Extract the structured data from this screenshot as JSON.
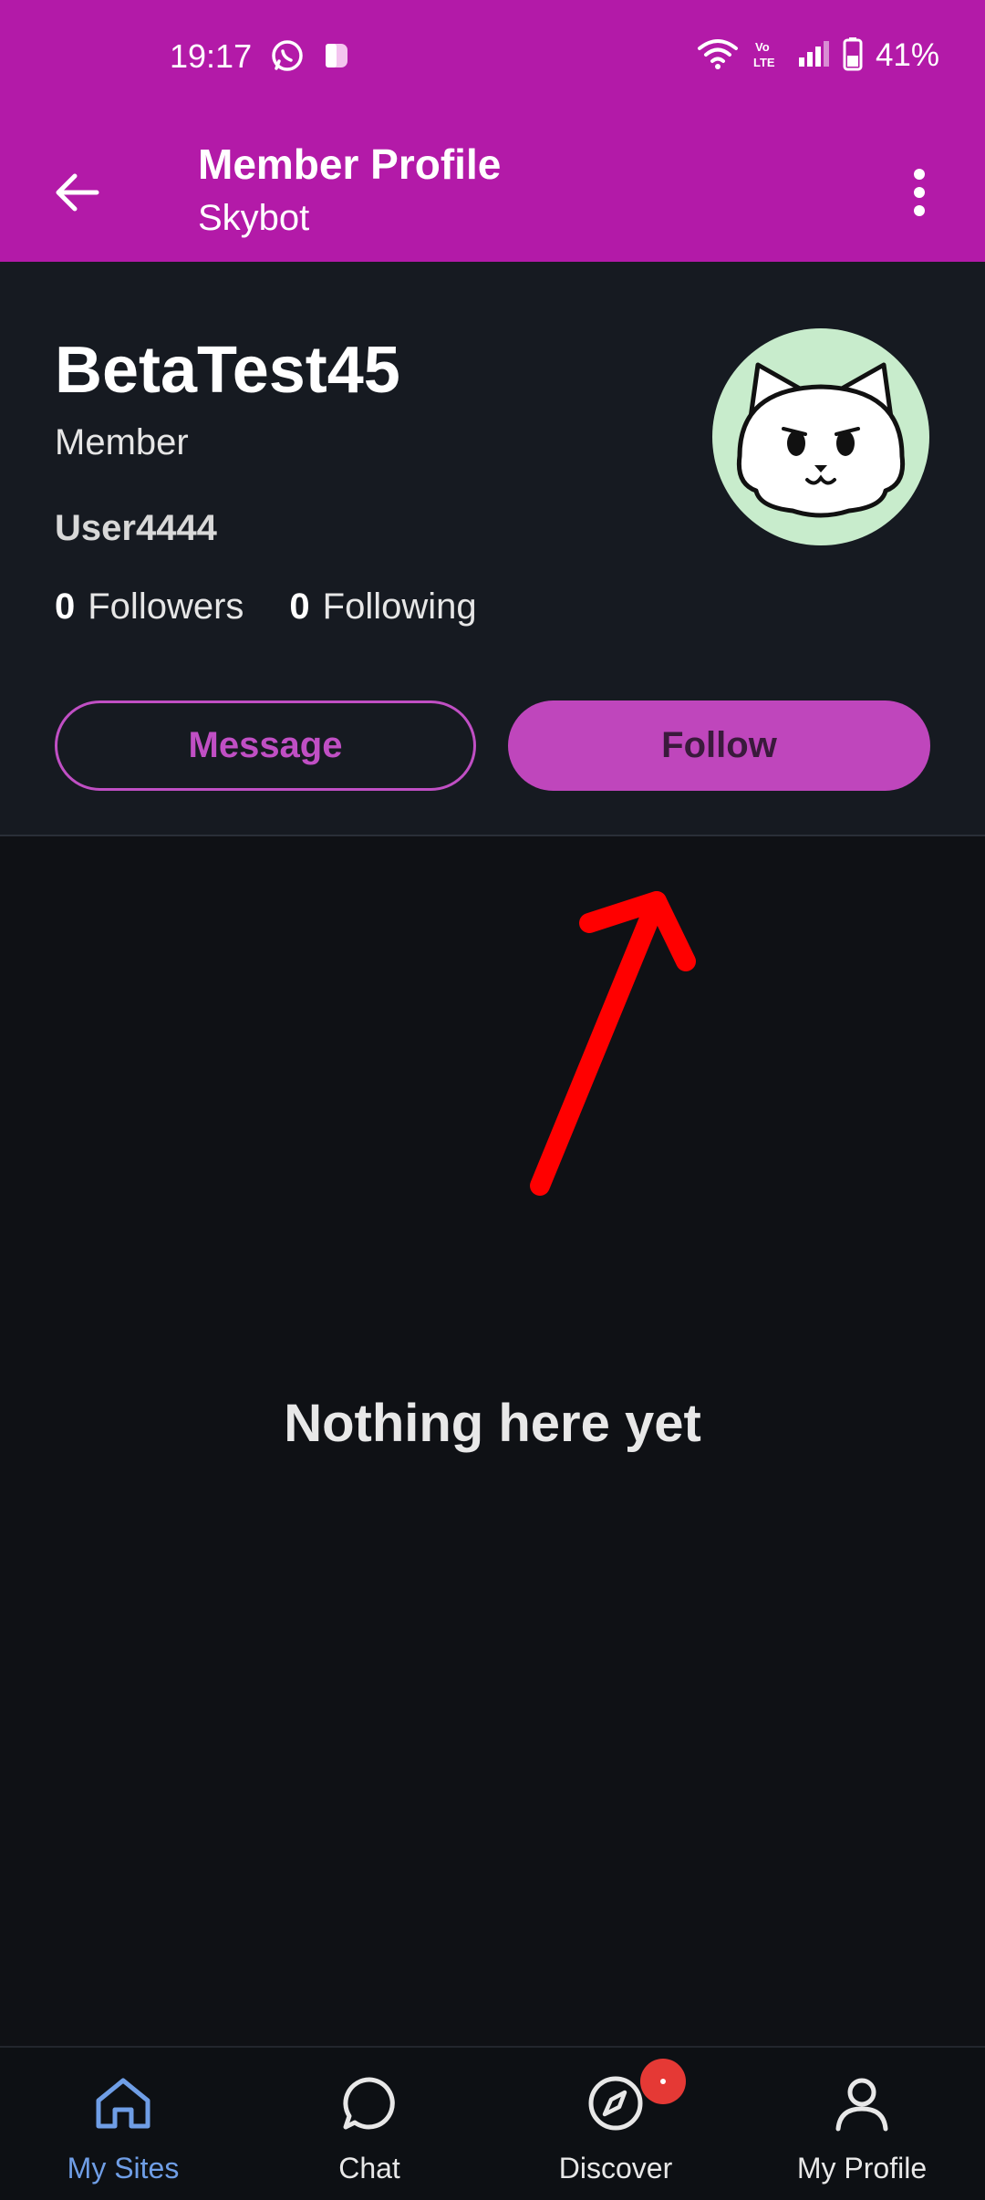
{
  "status_bar": {
    "time": "19:17",
    "battery": "41%",
    "app_icons": [
      "whatsapp-icon",
      "app-notification-icon"
    ],
    "system_icons": [
      "wifi-icon",
      "volte-icon",
      "signal-icon",
      "battery-icon"
    ]
  },
  "app_bar": {
    "title": "Member Profile",
    "subtitle": "Skybot"
  },
  "profile": {
    "display_name": "BetaTest45",
    "role": "Member",
    "username": "User4444",
    "followers_count": "0",
    "followers_label": "Followers",
    "following_count": "0",
    "following_label": "Following",
    "avatar": "cat-avatar"
  },
  "actions": {
    "message_label": "Message",
    "follow_label": "Follow"
  },
  "content": {
    "empty_text": "Nothing here yet"
  },
  "bottom_nav": {
    "items": [
      {
        "label": "My Sites",
        "icon": "home-icon",
        "active": true
      },
      {
        "label": "Chat",
        "icon": "chat-bubble-icon",
        "active": false
      },
      {
        "label": "Discover",
        "icon": "compass-icon",
        "active": false
      },
      {
        "label": "My Profile",
        "icon": "person-icon",
        "active": false
      }
    ]
  },
  "colors": {
    "brand": "#b31aa8",
    "accent": "#bf46bc",
    "background": "#0f1115",
    "card": "#161a21",
    "active_nav": "#6f9ee6",
    "badge": "#e53935",
    "annotation": "#ff0000"
  }
}
